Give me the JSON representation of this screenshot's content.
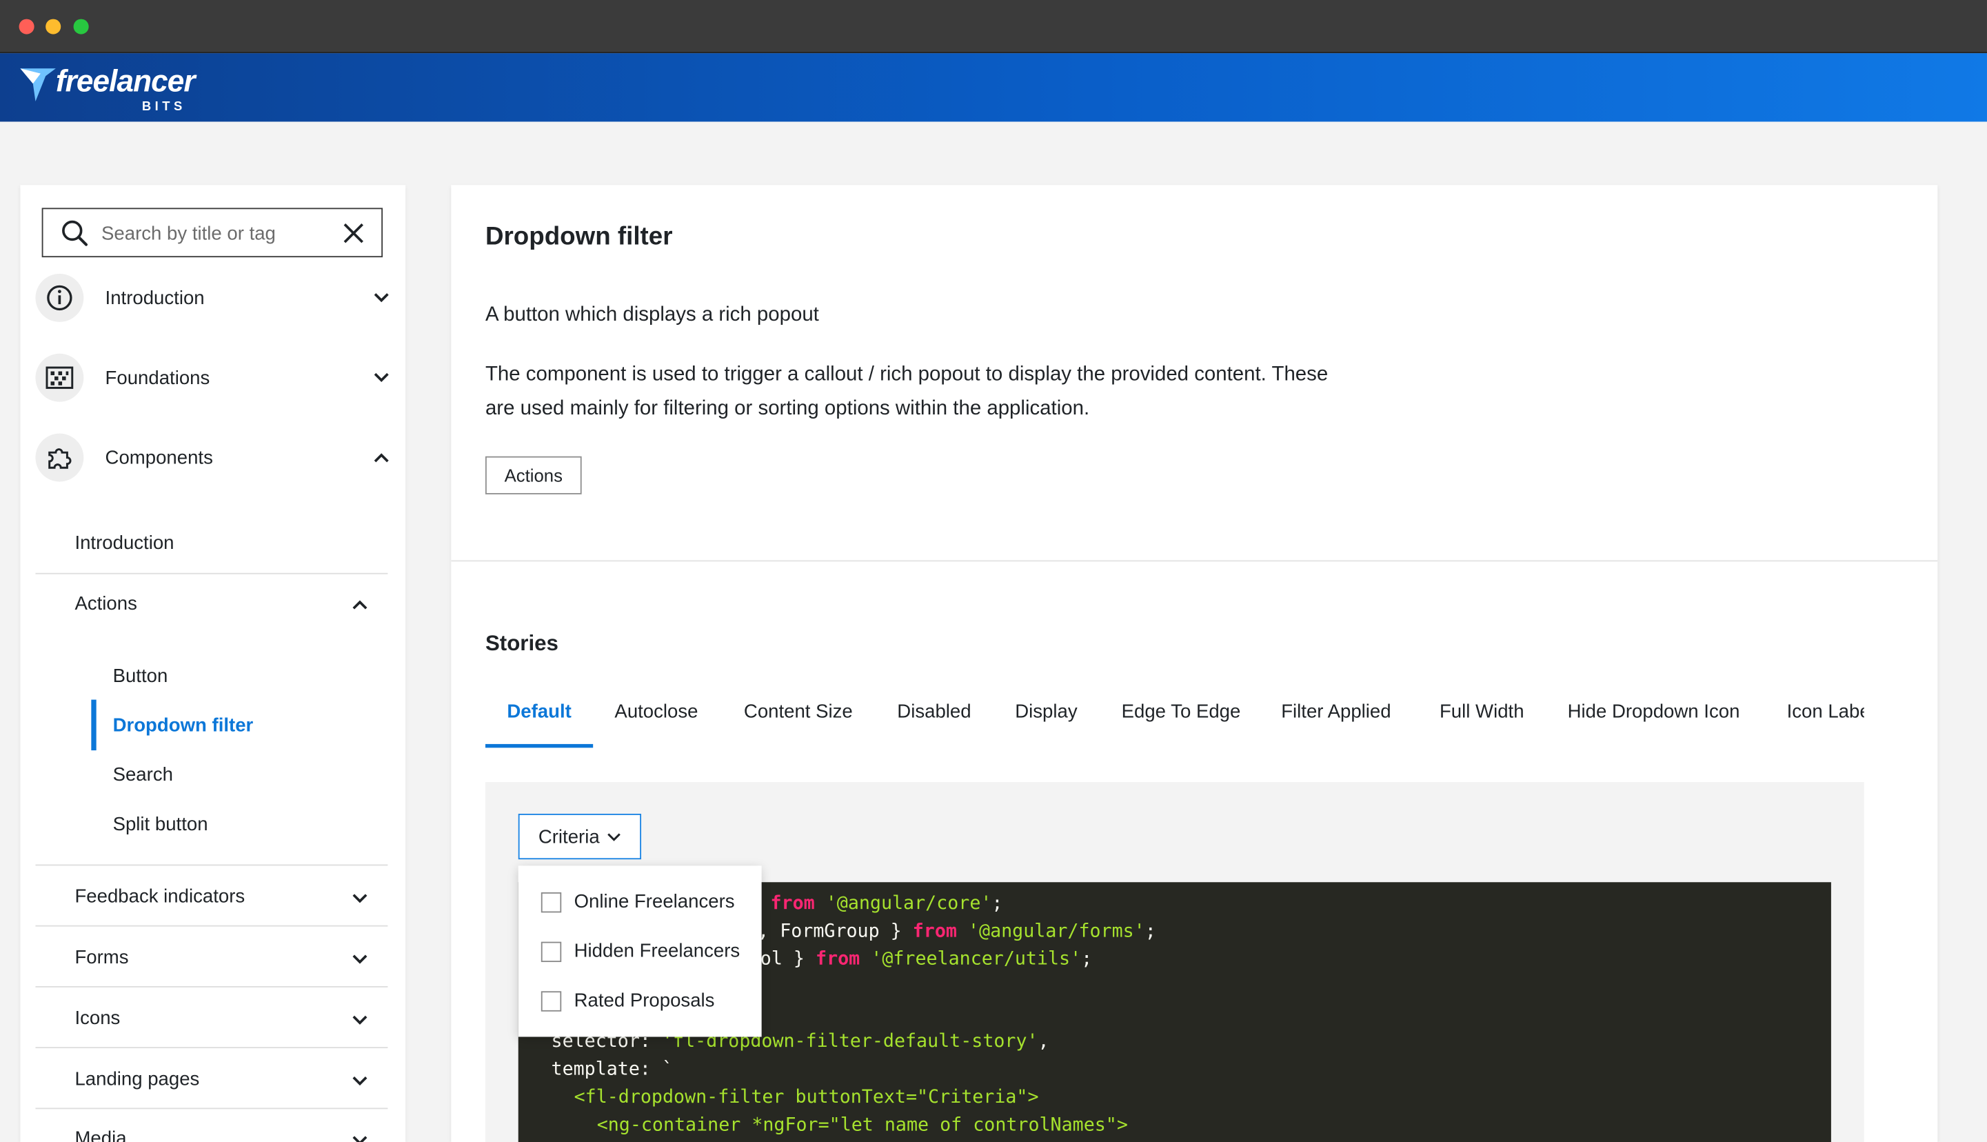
{
  "app": {
    "logo_text": "freelancer",
    "logo_subtext": "BITS"
  },
  "sidebar": {
    "search": {
      "placeholder": "Search by title or tag",
      "value": ""
    },
    "sections": [
      {
        "label": "Introduction",
        "icon": "info-icon",
        "expanded": false
      },
      {
        "label": "Foundations",
        "icon": "grid-pattern-icon",
        "expanded": false
      },
      {
        "label": "Components",
        "icon": "puzzle-icon",
        "expanded": true
      }
    ],
    "components": {
      "introduction_label": "Introduction",
      "actions_label": "Actions",
      "actions_items": [
        "Button",
        "Dropdown filter",
        "Search",
        "Split button"
      ],
      "active_item": "Dropdown filter",
      "groups": [
        "Feedback indicators",
        "Forms",
        "Icons",
        "Landing pages",
        "Media"
      ]
    }
  },
  "main": {
    "title": "Dropdown filter",
    "summary": "A button which displays a rich popout",
    "description": "The component is used to trigger a callout / rich popout to display the provided content. These are used mainly for filtering or sorting options within the application.",
    "tag": "Actions",
    "stories_heading": "Stories",
    "tabs": [
      "Default",
      "Autoclose",
      "Content Size",
      "Disabled",
      "Display",
      "Edge To Edge",
      "Filter Applied",
      "Full Width",
      "Hide Dropdown Icon",
      "Icon Label"
    ],
    "active_tab": "Default",
    "story": {
      "button_label": "Criteria",
      "options": [
        "Online Freelancers",
        "Hidden Freelancers",
        "Rated Proposals"
      ]
    },
    "code": {
      "line1_kw": "from",
      "line1_str": "'@angular/core'",
      "line1_end": ";",
      "line2_pre": ", FormGroup } ",
      "line2_kw": "from",
      "line2_str": "'@angular/forms'",
      "line2_end": ";",
      "line3_pre": "ol } ",
      "line3_kw": "from",
      "line3_str": "'@freelancer/utils'",
      "line3_end": ";",
      "line4_pre": "selector: ",
      "line4_str": "'fl-dropdown-filter-default-story'",
      "line4_end": ",",
      "line5": "template: `",
      "line6": "<fl-dropdown-filter buttonText=\"Criteria\">",
      "line7": "<ng-container *ngFor=\"let name of controlNames\">"
    }
  },
  "colors": {
    "accent": "#0c77d8",
    "header_gradient_start": "#0d3f8f",
    "header_gradient_end": "#1079e6",
    "code_bg": "#272822"
  }
}
